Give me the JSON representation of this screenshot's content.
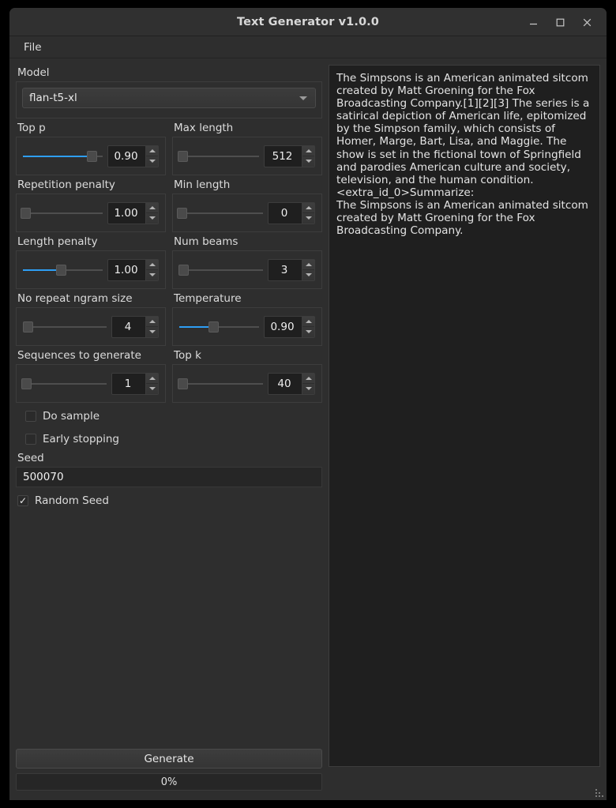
{
  "window": {
    "title": "Text Generator v1.0.0",
    "controls": [
      {
        "name": "minimize",
        "glyph": "minimize-icon"
      },
      {
        "name": "maximize",
        "glyph": "maximize-icon"
      },
      {
        "name": "close",
        "glyph": "close-icon"
      }
    ]
  },
  "menubar": {
    "items": [
      "File"
    ]
  },
  "model": {
    "label": "Model",
    "selected": "flan-t5-xl"
  },
  "parameters": [
    {
      "label": "Top p",
      "value": "0.90",
      "fill_pct": 86,
      "handle_pct": 86,
      "has_fill": true,
      "dot": false
    },
    {
      "label": "Max length",
      "value": "512",
      "fill_pct": 0,
      "handle_pct": 4,
      "has_fill": false,
      "dot": true
    },
    {
      "label": "Repetition penalty",
      "value": "1.00",
      "fill_pct": 0,
      "handle_pct": 3,
      "has_fill": false,
      "dot": false
    },
    {
      "label": "Min length",
      "value": "0",
      "fill_pct": 0,
      "handle_pct": 3,
      "has_fill": false,
      "dot": false
    },
    {
      "label": "Length penalty",
      "value": "1.00",
      "fill_pct": 48,
      "handle_pct": 48,
      "has_fill": true,
      "dot": false
    },
    {
      "label": "Num beams",
      "value": "3",
      "fill_pct": 0,
      "handle_pct": 5,
      "has_fill": false,
      "dot": true
    },
    {
      "label": "No repeat ngram size",
      "value": "4",
      "fill_pct": 0,
      "handle_pct": 6,
      "has_fill": false,
      "dot": true
    },
    {
      "label": "Temperature",
      "value": "0.90",
      "fill_pct": 43,
      "handle_pct": 43,
      "has_fill": true,
      "dot": false
    },
    {
      "label": "Sequences to generate",
      "value": "1",
      "fill_pct": 0,
      "handle_pct": 4,
      "has_fill": false,
      "dot": false
    },
    {
      "label": "Top k",
      "value": "40",
      "fill_pct": 0,
      "handle_pct": 4,
      "has_fill": false,
      "dot": false
    }
  ],
  "checkboxes": [
    {
      "label": "Do sample",
      "checked": false,
      "indent": true
    },
    {
      "label": "Early stopping",
      "checked": false,
      "indent": true
    }
  ],
  "seed": {
    "label": "Seed",
    "value": "500070",
    "random_label": "Random Seed",
    "random_checked": true
  },
  "actions": {
    "generate_label": "Generate",
    "progress_label": "0%",
    "progress_value": 0
  },
  "output": {
    "text": "The Simpsons is an American animated sitcom created by Matt Groening for the Fox Broadcasting Company.[1][2][3] The series is a satirical depiction of American life, epitomized by the Simpson family, which consists of Homer, Marge, Bart, Lisa, and Maggie. The show is set in the fictional town of Springfield and parodies American culture and society, television, and the human condition.\n<extra_id_0>Summarize:\nThe Simpsons is an American animated sitcom created by Matt Groening for the Fox Broadcasting Company."
  },
  "colors": {
    "accent": "#2e9ef4",
    "window_bg": "#2e2e2e",
    "panel_bg": "#1f1f1f",
    "titlebar_bg": "#303030",
    "text": "#dcdcdc"
  }
}
